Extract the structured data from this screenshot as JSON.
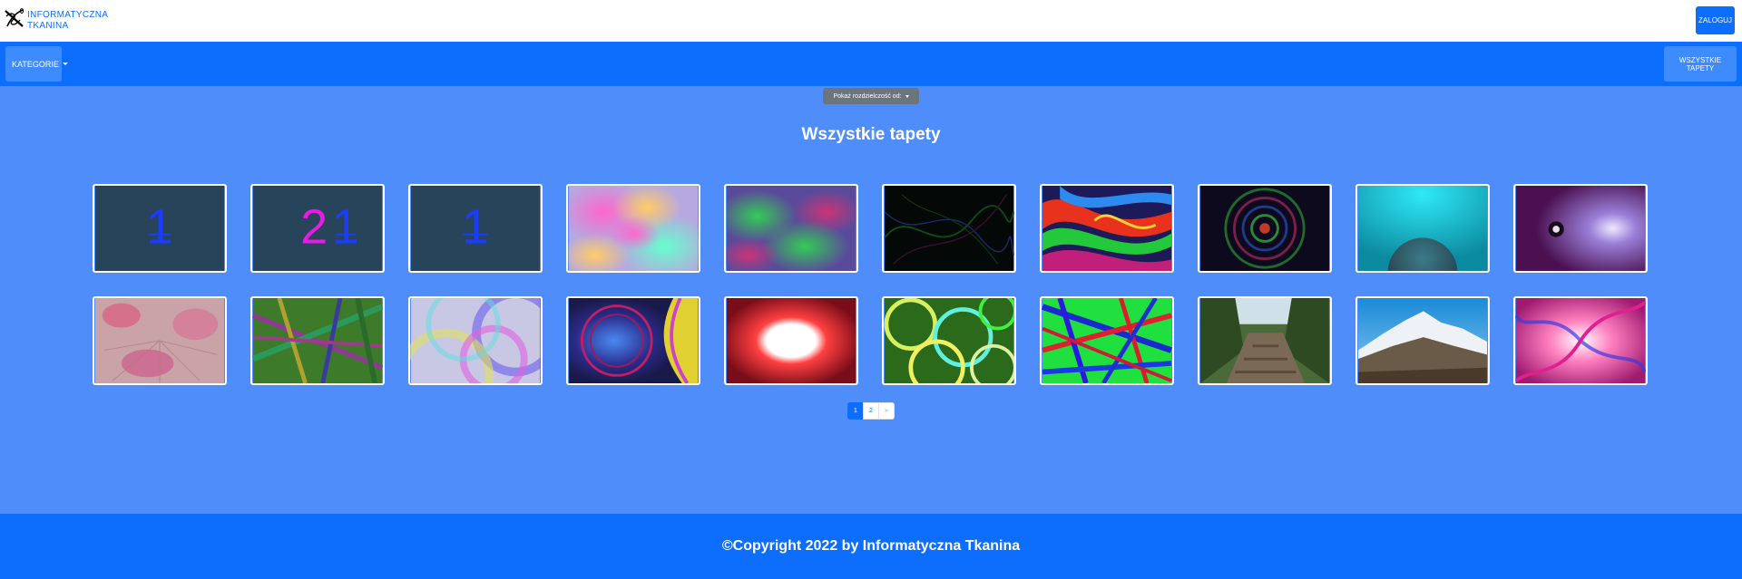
{
  "brand": {
    "line1": "INFORMATYCZNA",
    "line2": "TKANINA",
    "icon": "needle-thread-logo-icon"
  },
  "header": {
    "login_label": "ZALOGUJ"
  },
  "nav": {
    "categories_label": "KATEGORIE",
    "all_wallpapers_label": "WSZYSTKIE TAPETY"
  },
  "filter": {
    "resolution_label": "Pokaż rozdzielczość od:"
  },
  "main": {
    "title": "Wszystkie tapety"
  },
  "pagination": {
    "pages": [
      "1",
      "2",
      "»"
    ],
    "active": "1"
  },
  "footer": {
    "text": "©Copyright 2022 by Informatyczna Tkanina"
  },
  "thumbnails": {
    "row1": [
      {
        "kind": "digits",
        "text1": "1",
        "text2": ""
      },
      {
        "kind": "digits",
        "text1": "2",
        "text2": "1"
      },
      {
        "kind": "digits",
        "text1": "1",
        "text2": ""
      },
      {
        "kind": "pastel-clouds"
      },
      {
        "kind": "green-purple-clouds"
      },
      {
        "kind": "dark-threads"
      },
      {
        "kind": "color-swirl"
      },
      {
        "kind": "spiral-dark"
      },
      {
        "kind": "cyan-sphere"
      },
      {
        "kind": "purple-space"
      }
    ],
    "row2": [
      {
        "kind": "pink-flower"
      },
      {
        "kind": "green-lines"
      },
      {
        "kind": "pastel-circles"
      },
      {
        "kind": "blue-orb"
      },
      {
        "kind": "red-glow"
      },
      {
        "kind": "neon-rings"
      },
      {
        "kind": "rgb-lines"
      },
      {
        "kind": "forest-path"
      },
      {
        "kind": "mountains"
      },
      {
        "kind": "pink-swirl"
      }
    ]
  },
  "colors": {
    "primary": "#0d6efd",
    "main_bg": "#4f8dfb",
    "nav_button": "#3d8bfd",
    "filter_button": "#6c757d",
    "digit_bg": "#28445a",
    "digit_blue": "#1a3cff",
    "digit_magenta": "#e81ae6"
  }
}
